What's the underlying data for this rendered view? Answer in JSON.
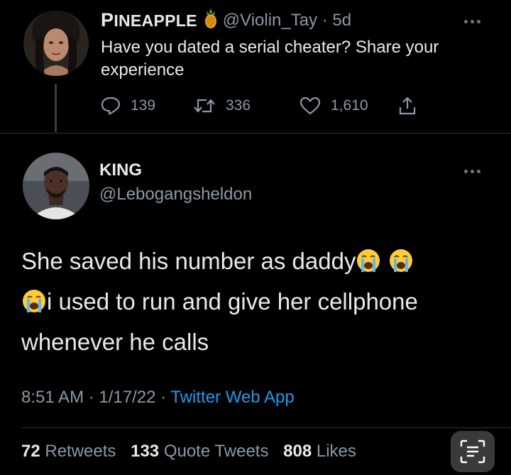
{
  "parent_tweet": {
    "display_name": "Pineapple",
    "handle": "@Violin_Tay",
    "separator": "·",
    "age": "5d",
    "text": "Have you dated a serial cheater? Share your experience",
    "reply_count": "139",
    "retweet_count": "336",
    "like_count": "1,610"
  },
  "main_tweet": {
    "display_name": "KING",
    "handle": "@Lebogangsheldon",
    "text_part1": "She saved his number as daddy",
    "text_part2": "i used to run and give her cellphone whenever he calls",
    "time": "8:51 AM",
    "date": "1/17/22",
    "separator": "·",
    "source": "Twitter Web App",
    "retweets_count": "72",
    "retweets_label": "Retweets",
    "quote_count": "133",
    "quote_label": "Quote Tweets",
    "likes_count": "808",
    "likes_label": "Likes"
  },
  "icons": {
    "reply": "reply-icon",
    "retweet": "retweet-icon",
    "like": "heart-icon",
    "share": "share-icon",
    "more": "more-icon",
    "emoji": "loudly-crying-face-emoji",
    "pineapple": "pineapple-emoji",
    "scan": "scan-text-icon"
  },
  "colors": {
    "background": "#000000",
    "text": "#e7e9ea",
    "muted": "#8b98a5",
    "link": "#1d9bf0",
    "divider": "#2f3336"
  }
}
